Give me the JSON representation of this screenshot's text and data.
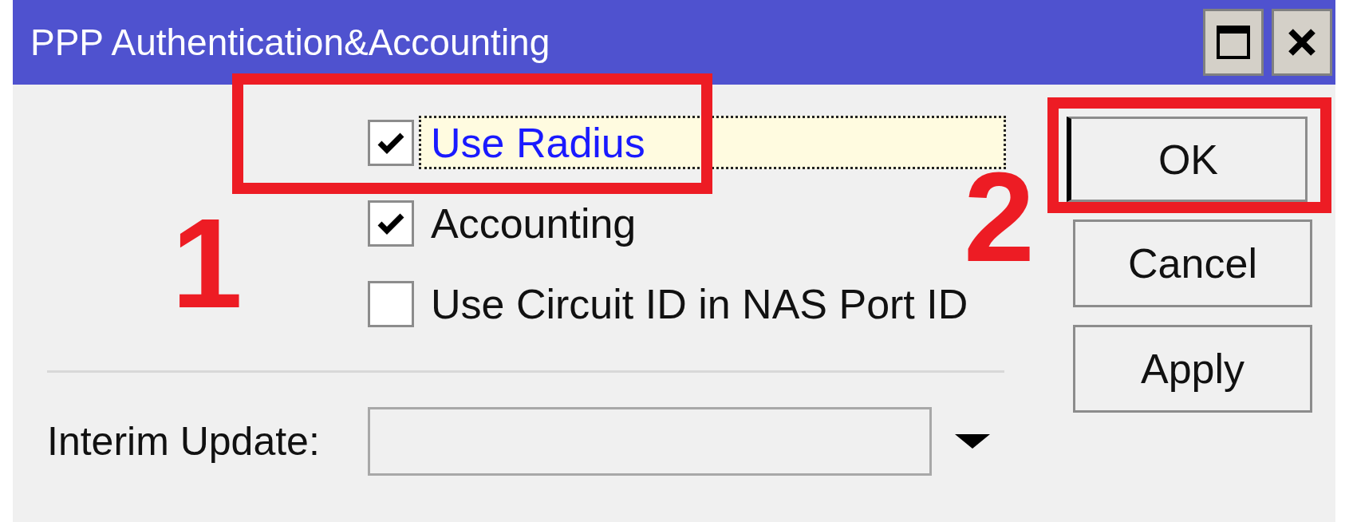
{
  "window": {
    "title": "PPP Authentication&Accounting"
  },
  "checkboxes": [
    {
      "label": "Use Radius",
      "checked": true,
      "focused": true
    },
    {
      "label": "Accounting",
      "checked": true,
      "focused": false
    },
    {
      "label": "Use Circuit ID in NAS Port ID",
      "checked": false,
      "focused": false
    }
  ],
  "interim_update": {
    "label": "Interim Update:"
  },
  "buttons": [
    {
      "label": "OK",
      "default": true
    },
    {
      "label": "Cancel",
      "default": false
    },
    {
      "label": "Apply",
      "default": false
    }
  ],
  "annotations": [
    {
      "text": "1"
    },
    {
      "text": "2"
    }
  ]
}
